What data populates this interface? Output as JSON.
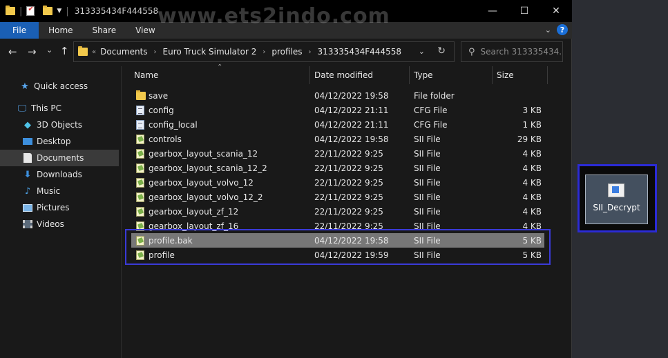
{
  "window": {
    "title": "313335434F444558",
    "minimize": "—",
    "maximize": "☐",
    "close": "✕"
  },
  "watermark": "www.ets2indo.com",
  "ribbon": {
    "tabs": [
      "File",
      "Home",
      "Share",
      "View"
    ],
    "collapse": "⌄",
    "help": "?"
  },
  "nav": {
    "back": "←",
    "forward": "→",
    "recent": "⌄",
    "up": "↑",
    "overflow": "«",
    "breadcrumb": [
      "Documents",
      "Euro Truck Simulator 2",
      "profiles",
      "313335434F444558"
    ],
    "search_placeholder": "Search 313335434..."
  },
  "sidebar": {
    "items": [
      {
        "label": "Quick access",
        "icon": "star-icon"
      },
      {
        "label": "This PC",
        "icon": "computer-icon"
      },
      {
        "label": "3D Objects",
        "icon": "cube-icon"
      },
      {
        "label": "Desktop",
        "icon": "desktop-icon"
      },
      {
        "label": "Documents",
        "icon": "documents-icon",
        "selected": true
      },
      {
        "label": "Downloads",
        "icon": "downloads-icon"
      },
      {
        "label": "Music",
        "icon": "music-icon"
      },
      {
        "label": "Pictures",
        "icon": "pictures-icon"
      },
      {
        "label": "Videos",
        "icon": "videos-icon"
      }
    ]
  },
  "columns": {
    "name": "Name",
    "date": "Date modified",
    "type": "Type",
    "size": "Size"
  },
  "files": [
    {
      "name": "save",
      "date": "04/12/2022 19:58",
      "type": "File folder",
      "size": "",
      "kind": "folder"
    },
    {
      "name": "config",
      "date": "04/12/2022 21:11",
      "type": "CFG File",
      "size": "3 KB",
      "kind": "cfg"
    },
    {
      "name": "config_local",
      "date": "04/12/2022 21:11",
      "type": "CFG File",
      "size": "1 KB",
      "kind": "cfg"
    },
    {
      "name": "controls",
      "date": "04/12/2022 19:58",
      "type": "SII File",
      "size": "29 KB",
      "kind": "sii"
    },
    {
      "name": "gearbox_layout_scania_12",
      "date": "22/11/2022 9:25",
      "type": "SII File",
      "size": "4 KB",
      "kind": "sii"
    },
    {
      "name": "gearbox_layout_scania_12_2",
      "date": "22/11/2022 9:25",
      "type": "SII File",
      "size": "4 KB",
      "kind": "sii"
    },
    {
      "name": "gearbox_layout_volvo_12",
      "date": "22/11/2022 9:25",
      "type": "SII File",
      "size": "4 KB",
      "kind": "sii"
    },
    {
      "name": "gearbox_layout_volvo_12_2",
      "date": "22/11/2022 9:25",
      "type": "SII File",
      "size": "4 KB",
      "kind": "sii"
    },
    {
      "name": "gearbox_layout_zf_12",
      "date": "22/11/2022 9:25",
      "type": "SII File",
      "size": "4 KB",
      "kind": "sii"
    },
    {
      "name": "gearbox_layout_zf_16",
      "date": "22/11/2022 9:25",
      "type": "SII File",
      "size": "4 KB",
      "kind": "sii"
    },
    {
      "name": "profile.bak",
      "date": "04/12/2022 19:58",
      "type": "SII File",
      "size": "5 KB",
      "kind": "sii",
      "selected": true
    },
    {
      "name": "profile",
      "date": "04/12/2022 19:59",
      "type": "SII File",
      "size": "5 KB",
      "kind": "sii"
    }
  ],
  "desktop": {
    "shortcut_label": "SII_Decrypt"
  }
}
